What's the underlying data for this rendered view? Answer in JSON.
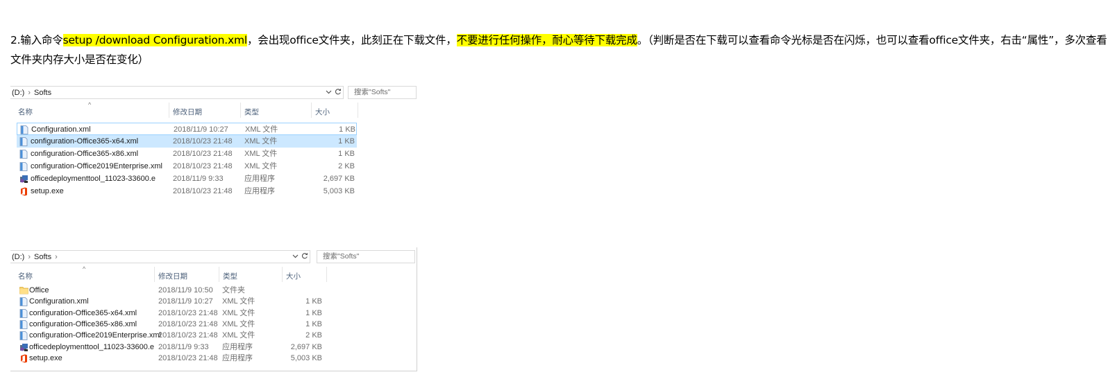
{
  "instruction": {
    "part1": "2.输入命令",
    "highlight1": "setup  /download Configuration.xml",
    "part2": "，会出现office文件夹，此刻正在下载文件，",
    "highlight2": "不要进行任何操作，耐心等待下载完成",
    "part3": "。（判断是否在下载可以查看命令光标是否在闪烁，也可以查看office文件夹，右击“属性”，多次查看文件夹内存大小是否在变化）"
  },
  "explorer_before": {
    "path": {
      "drive": "(D:)",
      "folder": "Softs"
    },
    "search_placeholder": "搜索\"Softs\"",
    "columns": {
      "name": "名称",
      "date": "修改日期",
      "type": "类型",
      "size": "大小"
    },
    "rows": [
      {
        "name": "Configuration.xml",
        "date": "2018/11/9 10:27",
        "type": "XML 文件",
        "size": "1 KB",
        "icon": "xml-file-icon"
      },
      {
        "name": "configuration-Office365-x64.xml",
        "date": "2018/10/23 21:48",
        "type": "XML 文件",
        "size": "1 KB",
        "icon": "xml-file-icon"
      },
      {
        "name": "configuration-Office365-x86.xml",
        "date": "2018/10/23 21:48",
        "type": "XML 文件",
        "size": "1 KB",
        "icon": "xml-file-icon"
      },
      {
        "name": "configuration-Office2019Enterprise.xml",
        "date": "2018/10/23 21:48",
        "type": "XML 文件",
        "size": "2 KB",
        "icon": "xml-file-icon"
      },
      {
        "name": "officedeploymenttool_11023-33600.e",
        "date": "2018/11/9 9:33",
        "type": "应用程序",
        "size": "2,697 KB",
        "icon": "installer-icon"
      },
      {
        "name": "setup.exe",
        "date": "2018/10/23 21:48",
        "type": "应用程序",
        "size": "5,003 KB",
        "icon": "office-logo-icon"
      }
    ]
  },
  "explorer_after": {
    "path": {
      "drive": "(D:)",
      "folder": "Softs"
    },
    "search_placeholder": "搜索\"Softs\"",
    "columns": {
      "name": "名称",
      "date": "修改日期",
      "type": "类型",
      "size": "大小"
    },
    "rows": [
      {
        "name": "Office",
        "date": "2018/11/9 10:50",
        "type": "文件夹",
        "size": "",
        "icon": "folder-icon"
      },
      {
        "name": "Configuration.xml",
        "date": "2018/11/9 10:27",
        "type": "XML 文件",
        "size": "1 KB",
        "icon": "xml-file-icon"
      },
      {
        "name": "configuration-Office365-x64.xml",
        "date": "2018/10/23 21:48",
        "type": "XML 文件",
        "size": "1 KB",
        "icon": "xml-file-icon"
      },
      {
        "name": "configuration-Office365-x86.xml",
        "date": "2018/10/23 21:48",
        "type": "XML 文件",
        "size": "1 KB",
        "icon": "xml-file-icon"
      },
      {
        "name": "configuration-Office2019Enterprise.xml",
        "date": "2018/10/23 21:48",
        "type": "XML 文件",
        "size": "2 KB",
        "icon": "xml-file-icon"
      },
      {
        "name": "officedeploymenttool_11023-33600.e",
        "date": "2018/11/9 9:33",
        "type": "应用程序",
        "size": "2,697 KB",
        "icon": "installer-icon"
      },
      {
        "name": "setup.exe",
        "date": "2018/10/23 21:48",
        "type": "应用程序",
        "size": "5,003 KB",
        "icon": "office-logo-icon"
      }
    ]
  }
}
